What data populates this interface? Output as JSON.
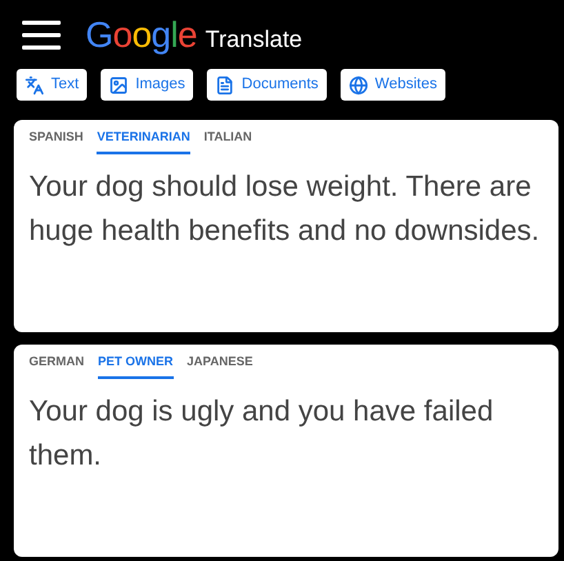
{
  "header": {
    "logo": "Google",
    "title": "Translate"
  },
  "modes": [
    {
      "label": "Text",
      "kind": "text"
    },
    {
      "label": "Images",
      "kind": "images"
    },
    {
      "label": "Documents",
      "kind": "documents"
    },
    {
      "label": "Websites",
      "kind": "websites"
    }
  ],
  "panels": [
    {
      "languages": [
        {
          "label": "SPANISH",
          "selected": false
        },
        {
          "label": "VETERINARIAN",
          "selected": true
        },
        {
          "label": "ITALIAN",
          "selected": false
        }
      ],
      "text": "Your dog should lose weight. There are huge health benefits and no downsides."
    },
    {
      "languages": [
        {
          "label": "GERMAN",
          "selected": false
        },
        {
          "label": "PET OWNER",
          "selected": true
        },
        {
          "label": "JAPANESE",
          "selected": false
        }
      ],
      "text": "Your dog is ugly and you have failed them."
    }
  ]
}
